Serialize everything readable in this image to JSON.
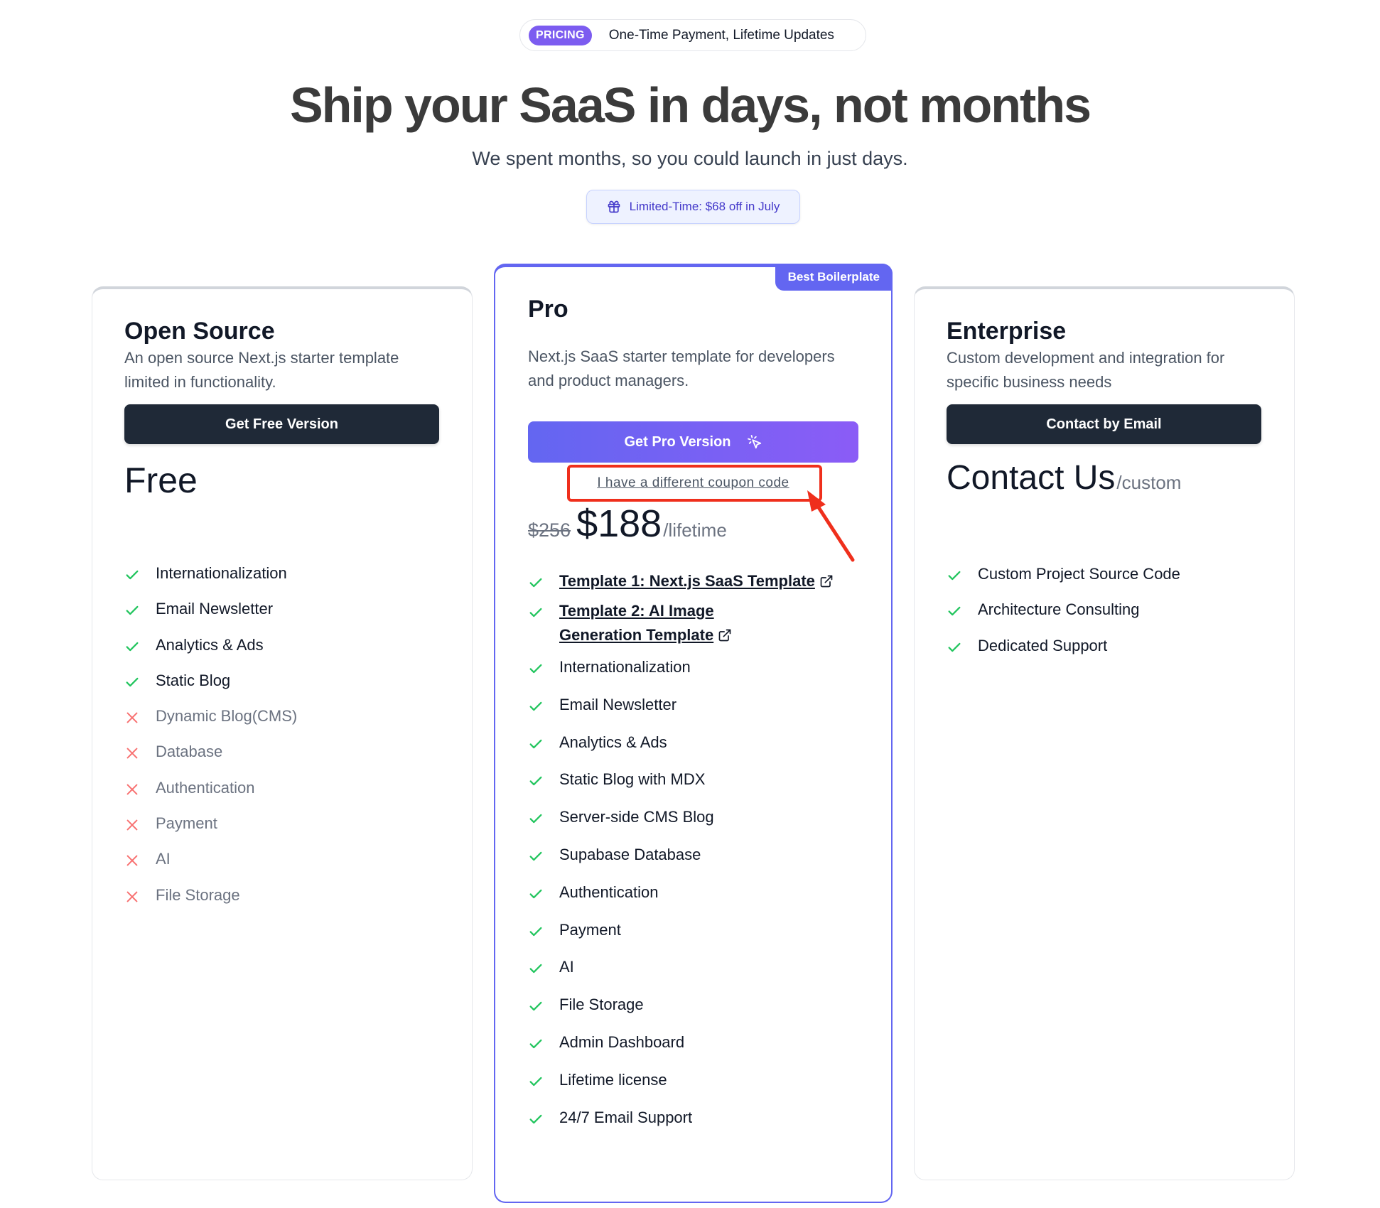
{
  "hero": {
    "tag": "PRICING",
    "pill_text": "One-Time Payment, Lifetime Updates",
    "title": "Ship your SaaS in days, not months",
    "subtitle": "We spent months, so you could launch in just days.",
    "promo": "Limited-Time: $68 off in July"
  },
  "plans": {
    "free": {
      "title": "Open Source",
      "description": "An open source Next.js starter template limited in functionality.",
      "button": "Get Free Version",
      "price": "Free",
      "features": [
        {
          "label": "Internationalization",
          "included": true
        },
        {
          "label": "Email Newsletter",
          "included": true
        },
        {
          "label": "Analytics & Ads",
          "included": true
        },
        {
          "label": "Static Blog",
          "included": true
        },
        {
          "label": "Dynamic Blog(CMS)",
          "included": false
        },
        {
          "label": "Database",
          "included": false
        },
        {
          "label": "Authentication",
          "included": false
        },
        {
          "label": "Payment",
          "included": false
        },
        {
          "label": "AI",
          "included": false
        },
        {
          "label": "File Storage",
          "included": false
        }
      ]
    },
    "pro": {
      "badge": "Best Boilerplate",
      "title": "Pro",
      "description": "Next.js SaaS starter template for developers and product managers.",
      "button": "Get Pro Version",
      "coupon_link": "I have a different coupon code",
      "price_old": "$256",
      "price": "$188",
      "price_unit": "/lifetime",
      "links": [
        {
          "label": "Template 1: Next.js SaaS Template"
        },
        {
          "label": "Template 2: AI Image Generation Template"
        }
      ],
      "features": [
        "Internationalization",
        "Email Newsletter",
        "Analytics & Ads",
        "Static Blog with MDX",
        "Server-side CMS Blog",
        "Supabase Database",
        "Authentication",
        "Payment",
        "AI",
        "File Storage",
        "Admin Dashboard",
        "Lifetime license",
        "24/7 Email Support"
      ]
    },
    "enterprise": {
      "title": "Enterprise",
      "description": "Custom development and integration for specific business needs",
      "button": "Contact by Email",
      "price": "Contact Us",
      "price_unit": "/custom",
      "features": [
        "Custom Project Source Code",
        "Architecture Consulting",
        "Dedicated Support"
      ]
    }
  },
  "colors": {
    "accent": "#6366f1",
    "accent_end": "#8b5cf6",
    "check": "#22c55e",
    "cross": "#f87171",
    "annotation": "#ef2f1c",
    "dark_button": "#1f2937"
  },
  "icons": {
    "check": "check-icon",
    "cross": "x-icon",
    "external": "external-link-icon",
    "gift": "gift-icon",
    "sparkle": "cursor-click-icon"
  }
}
